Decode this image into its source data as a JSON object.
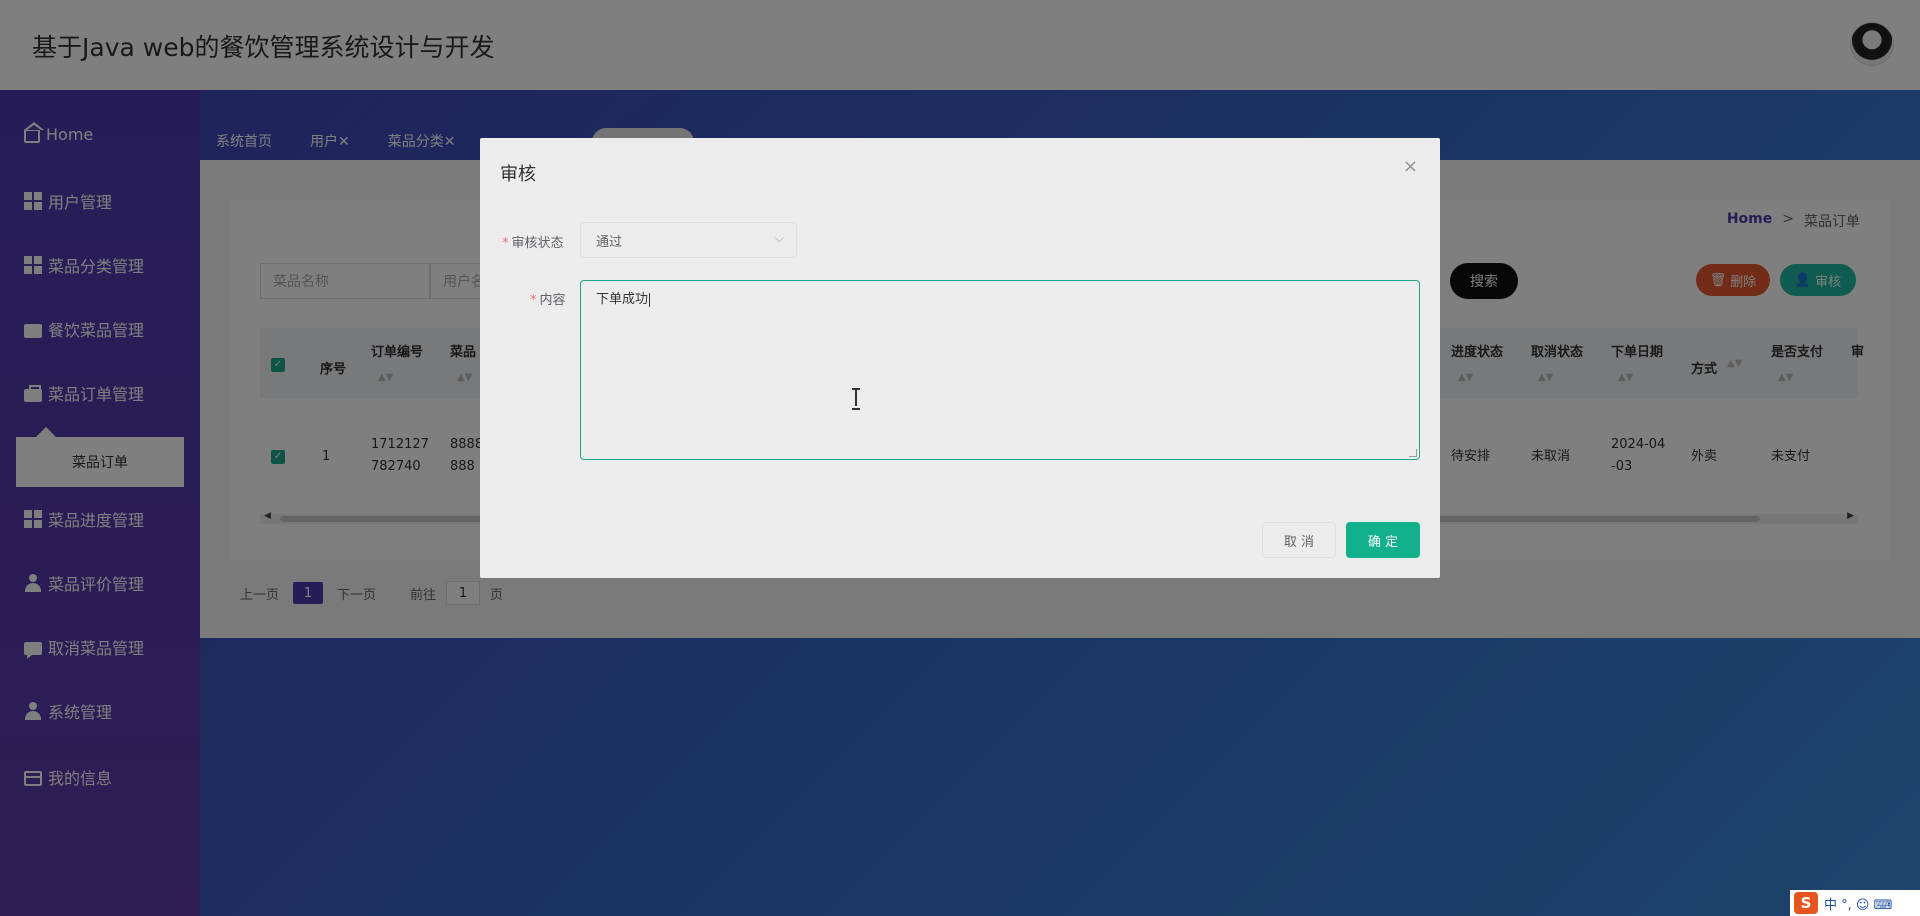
{
  "app": {
    "title": "基于Java web的餐饮管理系统设计与开发"
  },
  "sidebar": {
    "items": [
      {
        "label": "Home",
        "icon": "home-icon"
      },
      {
        "label": "用户管理",
        "icon": "grid-icon"
      },
      {
        "label": "菜品分类管理",
        "icon": "grid-icon"
      },
      {
        "label": "餐饮菜品管理",
        "icon": "wallet-icon"
      },
      {
        "label": "菜品订单管理",
        "icon": "briefcase-icon"
      },
      {
        "label": "菜品进度管理",
        "icon": "grid-icon"
      },
      {
        "label": "菜品评价管理",
        "icon": "user-icon"
      },
      {
        "label": "取消菜品管理",
        "icon": "chat-icon"
      },
      {
        "label": "系统管理",
        "icon": "user-icon"
      },
      {
        "label": "我的信息",
        "icon": "card-icon"
      }
    ],
    "submenu_label": "菜品订单"
  },
  "tabs": [
    {
      "label": "系统首页"
    },
    {
      "label": "用户✕"
    },
    {
      "label": "菜品分类✕"
    }
  ],
  "breadcrumb": {
    "home": "Home",
    "separator": ">",
    "current": "菜品订单"
  },
  "search": {
    "name_placeholder": "菜品名称",
    "user_placeholder": "用户名",
    "search_label": "搜索"
  },
  "actions": {
    "delete_label": "删除",
    "audit_label": "审核"
  },
  "table": {
    "headers": {
      "index": "序号",
      "order_no": "订单编号",
      "dish": "菜品",
      "progress": "进度状态",
      "cancel": "取消状态",
      "date": "下单日期",
      "mode": "方式",
      "paid": "是否支付",
      "audit": "审"
    },
    "rows": [
      {
        "index": "1",
        "order_no_l1": "1712127",
        "order_no_l2": "782740",
        "dish_l1": "8888",
        "dish_l2": "888",
        "progress": "待安排",
        "cancel": "未取消",
        "date_l1": "2024-04",
        "date_l2": "-03",
        "mode": "外卖",
        "paid": "未支付"
      }
    ]
  },
  "pager": {
    "prev": "上一页",
    "current": "1",
    "next": "下一页",
    "goto_prefix": "前往",
    "goto_value": "1",
    "goto_suffix": "页"
  },
  "dialog": {
    "title": "审核",
    "close": "×",
    "status_label": "审核状态",
    "status_value": "通过",
    "content_label": "内容",
    "content_value": "下单成功",
    "cancel_label": "取 消",
    "confirm_label": "确 定"
  },
  "ime": {
    "logo": "S",
    "text": "中 °, ☺ ⌨"
  },
  "colors": {
    "sidebar": "#4d3bb0",
    "accent": "#13b08e",
    "delete": "#e4572e",
    "audit": "#1fb6a0"
  }
}
